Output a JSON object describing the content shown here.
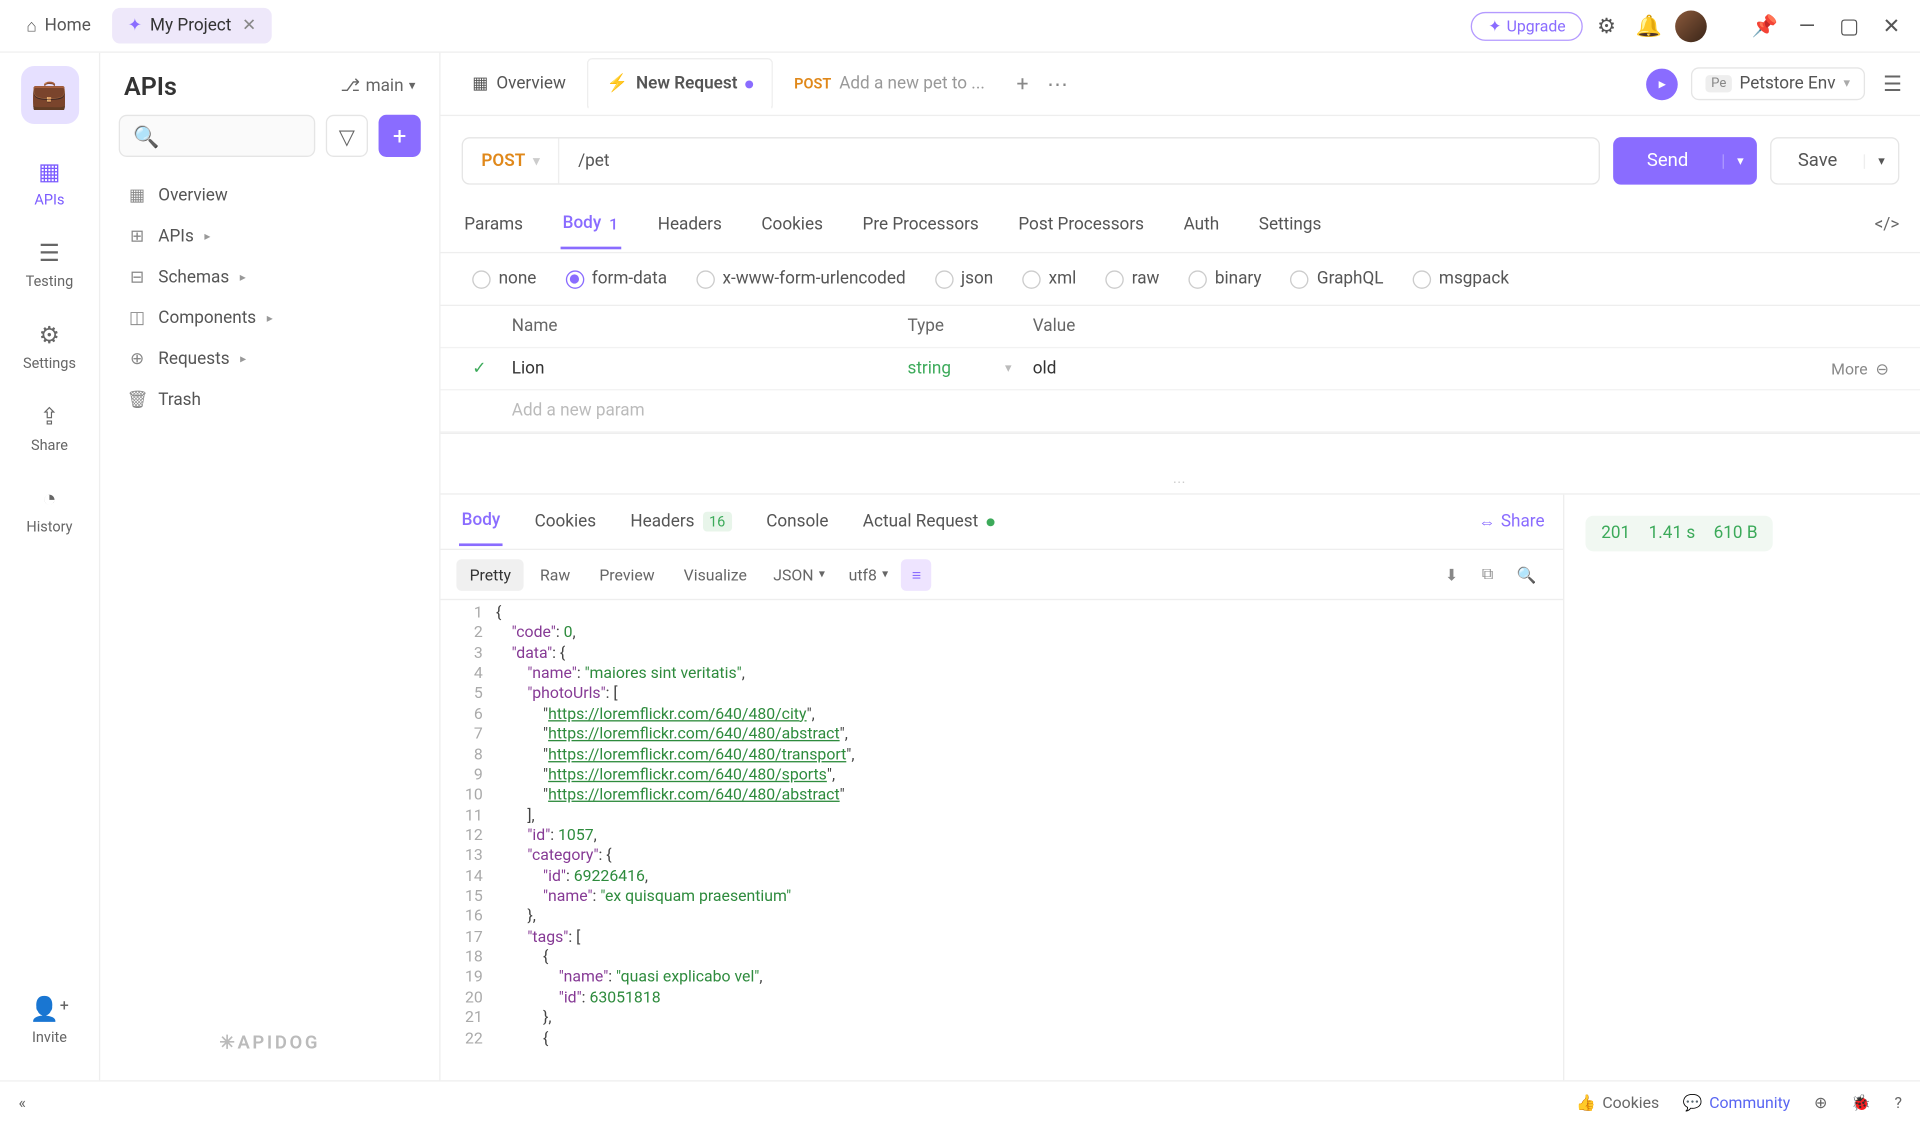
{
  "titlebar": {
    "home": "Home",
    "project_tab": "My Project",
    "upgrade": "Upgrade"
  },
  "rail": {
    "items": [
      {
        "label": "APIs"
      },
      {
        "label": "Testing"
      },
      {
        "label": "Settings"
      },
      {
        "label": "Share"
      },
      {
        "label": "History"
      }
    ],
    "invite": "Invite"
  },
  "sidebar": {
    "title": "APIs",
    "branch": "main",
    "tree": [
      {
        "label": "Overview"
      },
      {
        "label": "APIs"
      },
      {
        "label": "Schemas"
      },
      {
        "label": "Components"
      },
      {
        "label": "Requests"
      },
      {
        "label": "Trash"
      }
    ],
    "brand": "APIDOG"
  },
  "tabs": {
    "overview": "Overview",
    "new_request": "New Request",
    "petstore_method": "POST",
    "petstore_label": "Add a new pet to ...",
    "env_badge": "Pe",
    "env_name": "Petstore Env"
  },
  "request": {
    "method": "POST",
    "path": "/pet",
    "send": "Send",
    "save": "Save",
    "tabs": {
      "params": "Params",
      "body": "Body",
      "body_count": "1",
      "headers": "Headers",
      "cookies": "Cookies",
      "pre": "Pre Processors",
      "post": "Post Processors",
      "auth": "Auth",
      "settings": "Settings"
    },
    "body_types": [
      "none",
      "form-data",
      "x-www-form-urlencoded",
      "json",
      "xml",
      "raw",
      "binary",
      "GraphQL",
      "msgpack"
    ],
    "fd_headers": {
      "name": "Name",
      "type": "Type",
      "value": "Value"
    },
    "fd_row": {
      "name": "Lion",
      "type": "string",
      "value": "old"
    },
    "fd_more": "More",
    "fd_placeholder": "Add a new param"
  },
  "response": {
    "tabs": {
      "body": "Body",
      "cookies": "Cookies",
      "headers": "Headers",
      "headers_count": "16",
      "console": "Console",
      "actual": "Actual Request"
    },
    "share": "Share",
    "format": {
      "pretty": "Pretty",
      "raw": "Raw",
      "preview": "Preview",
      "visualize": "Visualize",
      "lang": "JSON",
      "enc": "utf8"
    },
    "meta": {
      "status": "201",
      "time": "1.41 s",
      "size": "610 B"
    },
    "json_lines": [
      {
        "n": 1,
        "indent": 0,
        "tokens": [
          {
            "t": "punct",
            "v": "{"
          }
        ]
      },
      {
        "n": 2,
        "indent": 1,
        "tokens": [
          {
            "t": "key",
            "v": "\"code\""
          },
          {
            "t": "punct",
            "v": ": "
          },
          {
            "t": "num",
            "v": "0"
          },
          {
            "t": "punct",
            "v": ","
          }
        ]
      },
      {
        "n": 3,
        "indent": 1,
        "tokens": [
          {
            "t": "key",
            "v": "\"data\""
          },
          {
            "t": "punct",
            "v": ": {"
          }
        ]
      },
      {
        "n": 4,
        "indent": 2,
        "tokens": [
          {
            "t": "key",
            "v": "\"name\""
          },
          {
            "t": "punct",
            "v": ": "
          },
          {
            "t": "str",
            "v": "\"maiores sint veritatis\""
          },
          {
            "t": "punct",
            "v": ","
          }
        ]
      },
      {
        "n": 5,
        "indent": 2,
        "tokens": [
          {
            "t": "key",
            "v": "\"photoUrls\""
          },
          {
            "t": "punct",
            "v": ": ["
          }
        ]
      },
      {
        "n": 6,
        "indent": 3,
        "tokens": [
          {
            "t": "punct",
            "v": "\""
          },
          {
            "t": "url",
            "v": "https://loremflickr.com/640/480/city"
          },
          {
            "t": "punct",
            "v": "\","
          }
        ]
      },
      {
        "n": 7,
        "indent": 3,
        "tokens": [
          {
            "t": "punct",
            "v": "\""
          },
          {
            "t": "url",
            "v": "https://loremflickr.com/640/480/abstract"
          },
          {
            "t": "punct",
            "v": "\","
          }
        ]
      },
      {
        "n": 8,
        "indent": 3,
        "tokens": [
          {
            "t": "punct",
            "v": "\""
          },
          {
            "t": "url",
            "v": "https://loremflickr.com/640/480/transport"
          },
          {
            "t": "punct",
            "v": "\","
          }
        ]
      },
      {
        "n": 9,
        "indent": 3,
        "tokens": [
          {
            "t": "punct",
            "v": "\""
          },
          {
            "t": "url",
            "v": "https://loremflickr.com/640/480/sports"
          },
          {
            "t": "punct",
            "v": "\","
          }
        ]
      },
      {
        "n": 10,
        "indent": 3,
        "tokens": [
          {
            "t": "punct",
            "v": "\""
          },
          {
            "t": "url",
            "v": "https://loremflickr.com/640/480/abstract"
          },
          {
            "t": "punct",
            "v": "\""
          }
        ]
      },
      {
        "n": 11,
        "indent": 2,
        "tokens": [
          {
            "t": "punct",
            "v": "],"
          }
        ]
      },
      {
        "n": 12,
        "indent": 2,
        "tokens": [
          {
            "t": "key",
            "v": "\"id\""
          },
          {
            "t": "punct",
            "v": ": "
          },
          {
            "t": "num",
            "v": "1057"
          },
          {
            "t": "punct",
            "v": ","
          }
        ]
      },
      {
        "n": 13,
        "indent": 2,
        "tokens": [
          {
            "t": "key",
            "v": "\"category\""
          },
          {
            "t": "punct",
            "v": ": {"
          }
        ]
      },
      {
        "n": 14,
        "indent": 3,
        "tokens": [
          {
            "t": "key",
            "v": "\"id\""
          },
          {
            "t": "punct",
            "v": ": "
          },
          {
            "t": "num",
            "v": "69226416"
          },
          {
            "t": "punct",
            "v": ","
          }
        ]
      },
      {
        "n": 15,
        "indent": 3,
        "tokens": [
          {
            "t": "key",
            "v": "\"name\""
          },
          {
            "t": "punct",
            "v": ": "
          },
          {
            "t": "str",
            "v": "\"ex quisquam praesentium\""
          }
        ]
      },
      {
        "n": 16,
        "indent": 2,
        "tokens": [
          {
            "t": "punct",
            "v": "},"
          }
        ]
      },
      {
        "n": 17,
        "indent": 2,
        "tokens": [
          {
            "t": "key",
            "v": "\"tags\""
          },
          {
            "t": "punct",
            "v": ": ["
          }
        ]
      },
      {
        "n": 18,
        "indent": 3,
        "tokens": [
          {
            "t": "punct",
            "v": "{"
          }
        ]
      },
      {
        "n": 19,
        "indent": 4,
        "tokens": [
          {
            "t": "key",
            "v": "\"name\""
          },
          {
            "t": "punct",
            "v": ": "
          },
          {
            "t": "str",
            "v": "\"quasi explicabo vel\""
          },
          {
            "t": "punct",
            "v": ","
          }
        ]
      },
      {
        "n": 20,
        "indent": 4,
        "tokens": [
          {
            "t": "key",
            "v": "\"id\""
          },
          {
            "t": "punct",
            "v": ": "
          },
          {
            "t": "num",
            "v": "63051818"
          }
        ]
      },
      {
        "n": 21,
        "indent": 3,
        "tokens": [
          {
            "t": "punct",
            "v": "},"
          }
        ]
      },
      {
        "n": 22,
        "indent": 3,
        "tokens": [
          {
            "t": "punct",
            "v": "{"
          }
        ]
      }
    ]
  },
  "statusbar": {
    "cookies": "Cookies",
    "community": "Community"
  }
}
